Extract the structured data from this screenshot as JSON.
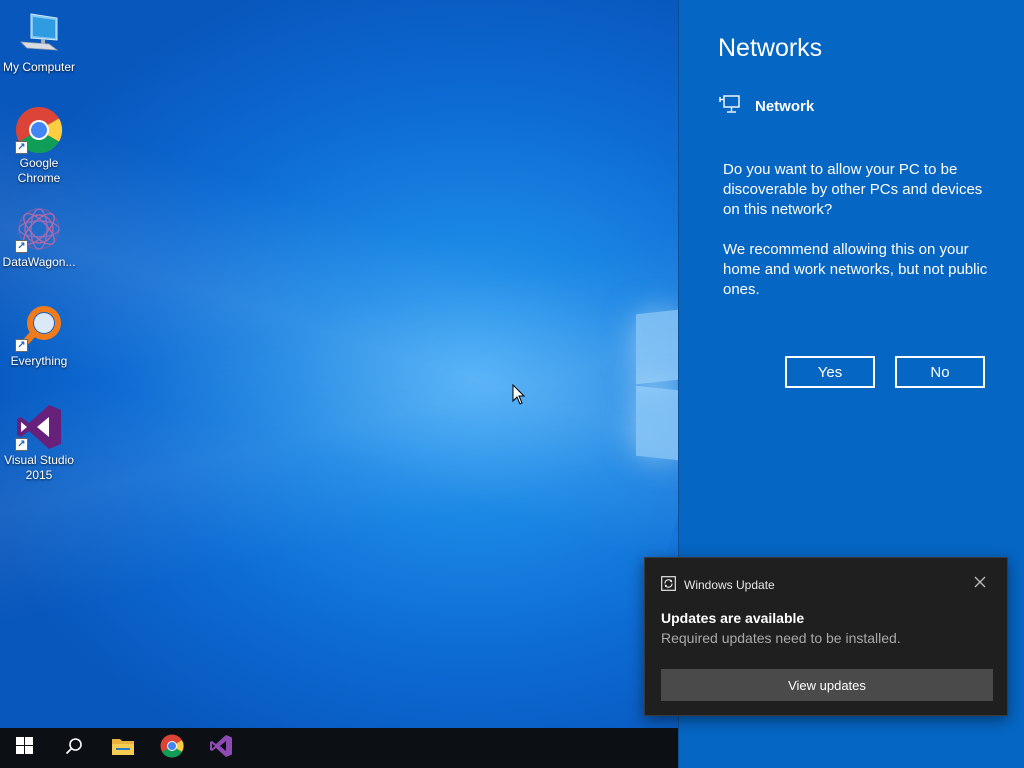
{
  "desktop": {
    "icons": [
      {
        "label": "My Computer",
        "icon": "computer-icon",
        "shortcut": false
      },
      {
        "label": "Google\nChrome",
        "icon": "chrome-icon",
        "shortcut": true
      },
      {
        "label": "DataWagon...",
        "icon": "datawagon-icon",
        "shortcut": true
      },
      {
        "label": "Everything",
        "icon": "everything-search-icon",
        "shortcut": true
      },
      {
        "label": "Visual Studio\n2015",
        "icon": "visual-studio-icon",
        "shortcut": true
      }
    ]
  },
  "networks_panel": {
    "title": "Networks",
    "network_name": "Network",
    "question": "Do you want to allow your PC to be discoverable by other PCs and devices on this network?",
    "recommendation": "We recommend allowing this on your home and work networks, but not public ones.",
    "yes_label": "Yes",
    "no_label": "No"
  },
  "toast": {
    "app_name": "Windows Update",
    "title": "Updates are available",
    "body": "Required updates need to be installed.",
    "button_label": "View updates"
  },
  "taskbar": {
    "items": [
      "start-icon",
      "search-icon",
      "file-explorer-icon",
      "chrome-icon",
      "visual-studio-icon"
    ]
  },
  "colors": {
    "panel_bg": "#0566c4",
    "toast_bg": "#1f1f1f",
    "taskbar_bg": "#0c0f14",
    "vs_purple": "#68217a"
  }
}
